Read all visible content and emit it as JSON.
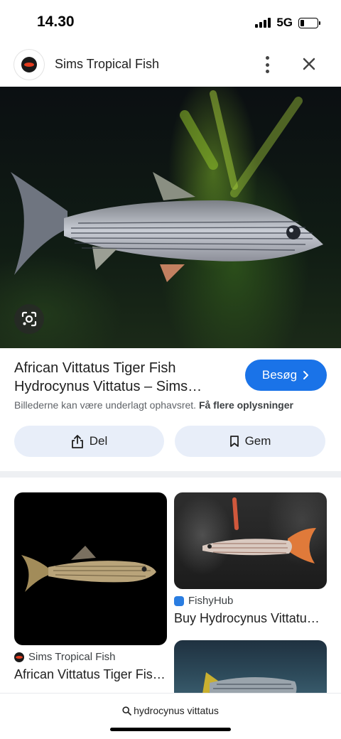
{
  "status": {
    "time": "14.30",
    "network": "5G"
  },
  "header": {
    "site_name": "Sims Tropical Fish"
  },
  "result": {
    "title_line1": "African Vittatus Tiger Fish",
    "title_line2": "Hydrocynus Vittatus – Sims…",
    "visit_label": "Besøg",
    "copyright_text": "Billederne kan være underlagt ophavsret.",
    "more_info_link": "Få flere oplysninger",
    "share_label": "Del",
    "save_label": "Gem"
  },
  "related": [
    {
      "source": "Sims Tropical Fish",
      "title": "African Vittatus Tiger Fis…"
    },
    {
      "source": "FishyHub",
      "title": "Buy Hydrocynus Vittatu…"
    }
  ],
  "search": {
    "query": "hydrocynus vittatus"
  },
  "icons": {
    "more": "more-vert-icon",
    "close": "close-icon",
    "lens": "google-lens-icon",
    "share": "share-icon",
    "save": "bookmark-icon",
    "visit": "chevron-right-icon",
    "search": "search-icon"
  },
  "colors": {
    "accent": "#1a73e8",
    "pill_bg": "#e8eef9"
  }
}
